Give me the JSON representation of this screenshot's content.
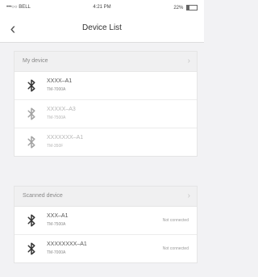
{
  "status_bar": {
    "carrier": "•••○○ BELL",
    "time": "4:21 PM",
    "battery": "22%"
  },
  "nav": {
    "back_glyph": "‹",
    "title": "Device List"
  },
  "my_devices": {
    "header": "My device",
    "items": [
      {
        "name": "XXXX–A1",
        "model": "TM-7000A"
      },
      {
        "name": "XXXXX–A3",
        "model": "TM-7500A"
      },
      {
        "name": "XXXXXXX–A1",
        "model": "TM-350F"
      }
    ]
  },
  "scanned_devices": {
    "header": "Scanned device",
    "items": [
      {
        "name": "XXX–A1",
        "model": "TM-7500A",
        "status": "Not connected"
      },
      {
        "name": "XXXXXXXX–A1",
        "model": "TM-7000A",
        "status": "Not connected"
      }
    ]
  },
  "icons": {
    "device_icon": "bluetooth-icon",
    "chevron": "chevron-right-icon"
  },
  "colors": {
    "background": "#f2f2f4",
    "section_header": "#f0f0f1",
    "text": "#333333"
  }
}
